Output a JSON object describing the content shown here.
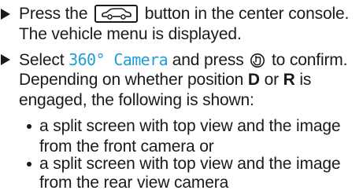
{
  "steps": [
    {
      "line1_before": "Press the",
      "line1_after": "button in the center console.",
      "line2": "The vehicle menu is displayed.",
      "key_icon": "vehicle-car-icon"
    },
    {
      "line1_before": "Select",
      "display_text": "360° Camera",
      "line1_mid": "and press",
      "line1_after": "to confirm.",
      "line2_before": "Depending on whether position",
      "pos_d": "D",
      "line2_mid": "or",
      "pos_r": "R",
      "line2_after": "is",
      "line3": "engaged, the following is shown:",
      "controller_icon": "controller-press-icon"
    }
  ],
  "bullets": [
    {
      "line1": "a split screen with top view and the image",
      "line2": "from the front camera or"
    },
    {
      "line1": "a split screen with top view and the image",
      "line2": "from the rear view camera"
    }
  ]
}
